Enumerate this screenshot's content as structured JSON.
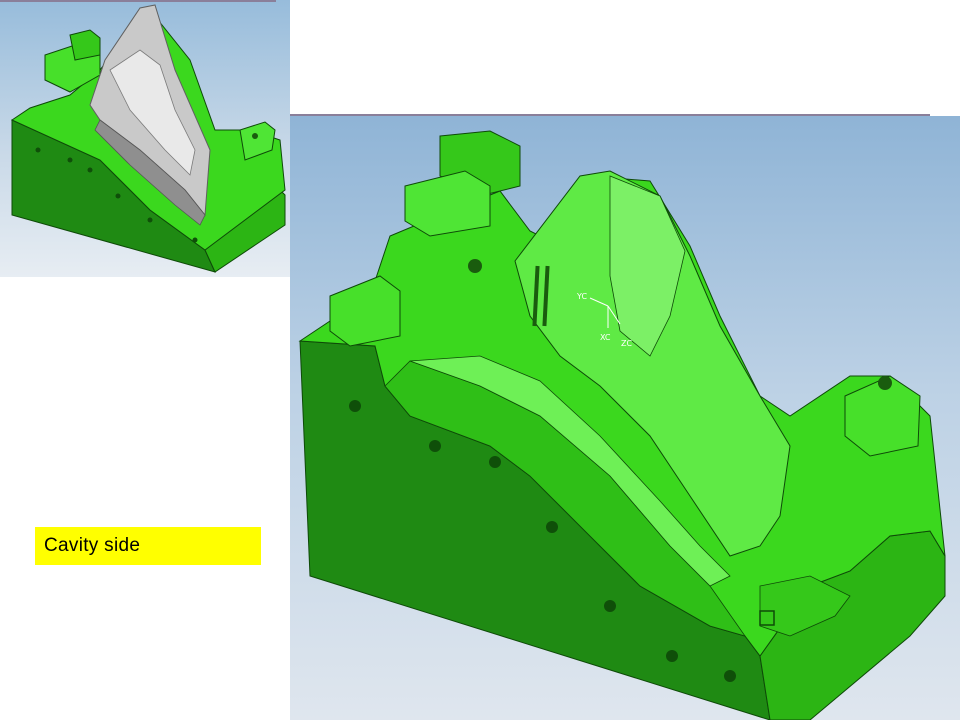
{
  "caption": {
    "text": "Cavity side"
  },
  "views": {
    "thumbnail": {
      "content": "mold-block-with-part"
    },
    "main": {
      "content": "mold-cavity-block",
      "triad": {
        "y_label": "YC",
        "x_label": "XC",
        "z_label": "ZC"
      }
    }
  },
  "colors": {
    "mold_green": "#3bd81e",
    "mold_dark": "#1f8a13",
    "mold_shadow": "#1b6e10",
    "mold_light": "#7cf066",
    "part_gray": "#c9c9c9",
    "caption_bg": "#ffff00"
  }
}
